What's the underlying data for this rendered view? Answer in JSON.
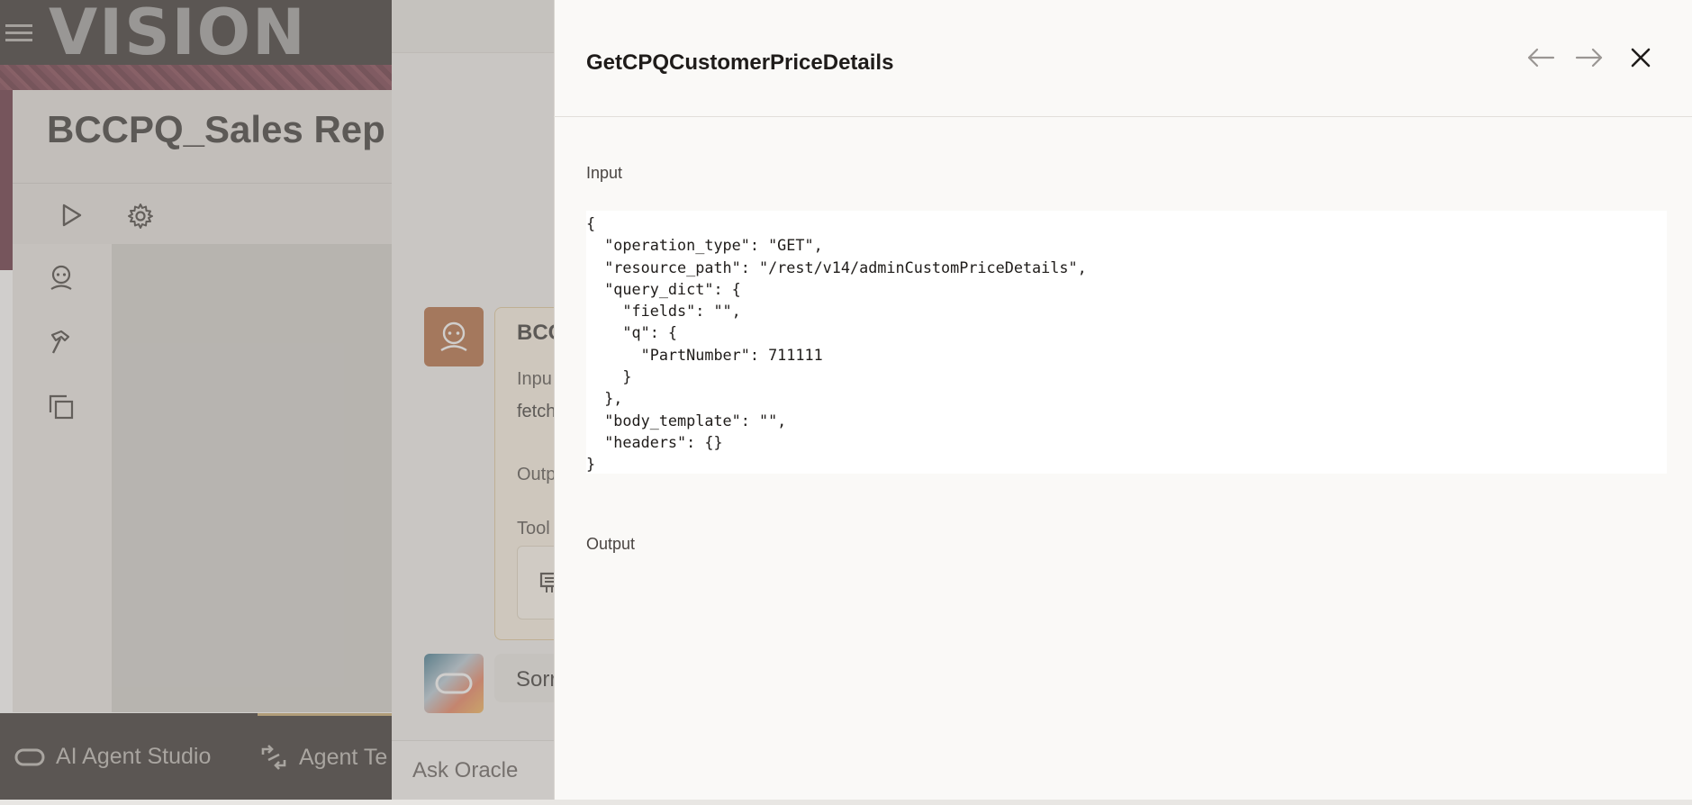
{
  "background_app": {
    "brand_logo": "VISION",
    "page_title": "BCCPQ_Sales Rep A",
    "bottom_nav": {
      "studio_label": "AI Agent Studio",
      "team_label": "Agent Te"
    }
  },
  "chat": {
    "card_title": "BCC",
    "card_input_label": "Inpu",
    "card_input_value": "fetch",
    "card_output_label": "Outp",
    "card_tools_label": "Tool",
    "reply_text": "Sorr",
    "ask_placeholder": "Ask Oracle"
  },
  "drawer": {
    "title": "GetCPQCustomerPriceDetails",
    "input_label": "Input",
    "input_code": "{\n  \"operation_type\": \"GET\",\n  \"resource_path\": \"/rest/v14/adminCustomPriceDetails\",\n  \"query_dict\": {\n    \"fields\": \"\",\n    \"q\": {\n      \"PartNumber\": 711111\n    }\n  },\n  \"body_template\": \"\",\n  \"headers\": {}\n}",
    "output_label": "Output"
  },
  "icons": {
    "menu": "hamburger-menu-icon",
    "run": "play-icon",
    "settings": "gear-icon",
    "agent": "agent-icon",
    "tools": "hammer-icon",
    "copy": "copy-icon",
    "prev": "arrow-left-icon",
    "next": "arrow-right-icon",
    "close": "close-icon"
  },
  "colors": {
    "header_dark": "#2b2523",
    "agent_avatar": "#b06335",
    "accent_gold": "#c7a769",
    "drawer_bg": "#faf9f7"
  }
}
